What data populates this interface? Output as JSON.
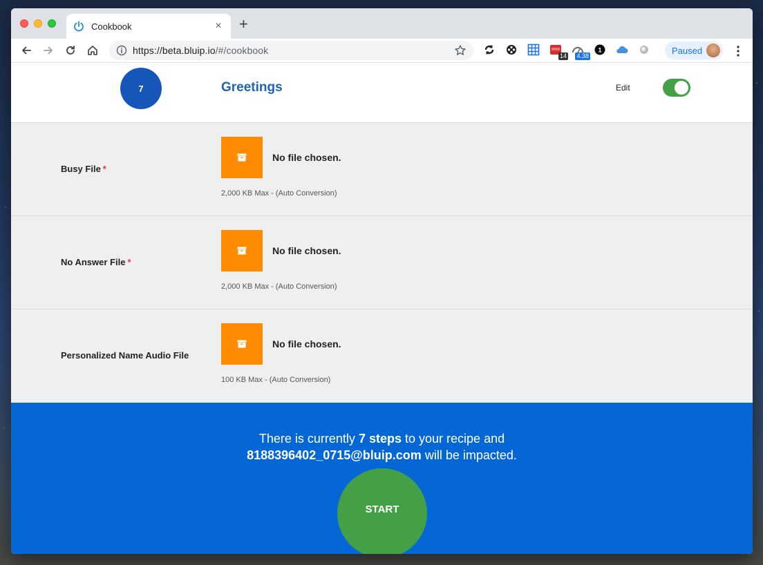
{
  "browser": {
    "tab_title": "Cookbook",
    "url_host": "https://beta.bluip.io",
    "url_path": "/#/cookbook",
    "profile_label": "Paused",
    "extensions": [
      {
        "icon": "sync-icon"
      },
      {
        "icon": "film-reel-icon"
      },
      {
        "icon": "grid-icon",
        "color": "#1a73e8"
      },
      {
        "icon": "calendar-icon",
        "badge": "14",
        "color": "#d32f2f"
      },
      {
        "icon": "speedometer-icon",
        "badge": "4.38",
        "color": "#1a73e8"
      },
      {
        "icon": "1password-icon",
        "label": "1"
      },
      {
        "icon": "cloud-icon",
        "color": "#4a90d9"
      },
      {
        "icon": "circle-icon"
      }
    ]
  },
  "header": {
    "step_number": "7",
    "title": "Greetings",
    "edit_label": "Edit",
    "edit_enabled": true
  },
  "files": [
    {
      "label": "Busy File",
      "required": "*",
      "status": "No file chosen.",
      "limit": "2,000 KB Max - (Auto Conversion)"
    },
    {
      "label": "No Answer File",
      "required": "*",
      "status": "No file chosen.",
      "limit": "2,000 KB Max - (Auto Conversion)"
    },
    {
      "label": "Personalized Name Audio File",
      "required": "",
      "status": "No file chosen.",
      "limit": "100 KB Max - (Auto Conversion)"
    }
  ],
  "footer": {
    "line1_prefix": "There is currently",
    "line1_bold": "7 steps",
    "line1_suffix": "to your recipe and",
    "line2_bold": "8188396402_0715@bluip.com",
    "line2_suffix": "will be impacted.",
    "start_label": "START"
  },
  "colors": {
    "accent_blue": "#0567d6",
    "title_blue": "#1f63b8",
    "upload_orange": "#ff8c00",
    "toggle_green": "#43a047",
    "required_red": "#e53935"
  }
}
